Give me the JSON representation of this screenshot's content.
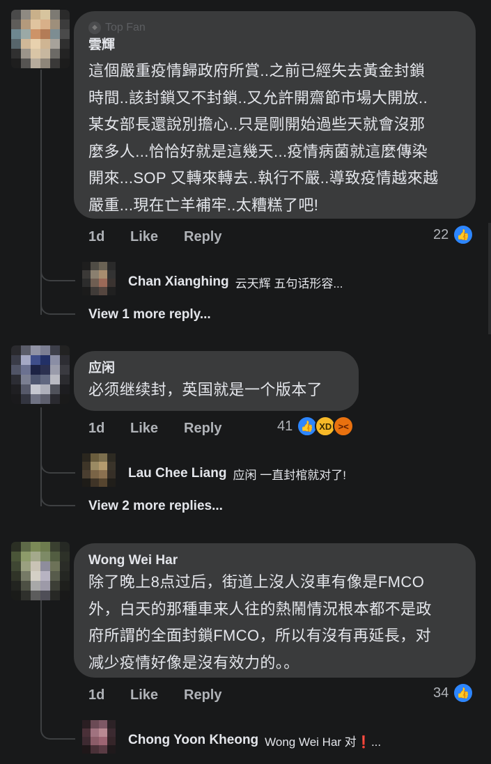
{
  "comments": [
    {
      "badge": "Top Fan",
      "badge_icon": "diamond-icon",
      "author": "雲輝",
      "lines": [
        "這個嚴重疫情歸政府所賞..之前已經失去黃金封鎖",
        "時間..該封鎖又不封鎖..又允許開齋節市場大開放..",
        "某女部長還說別擔心..只是剛開始過些天就會沒那",
        "麼多人...恰恰好就是這幾天...疫情病菌就這麼傳染",
        "開來...SOP 又轉來轉去..執行不嚴..導致疫情越來越",
        "嚴重...現在亡羊補牢..太糟糕了吧!"
      ],
      "age": "1d",
      "like_label": "Like",
      "reply_label": "Reply",
      "reaction_count": "22",
      "reactions": [
        "like-icon"
      ],
      "reply": {
        "author": "Chan Xianghing",
        "text": "云天辉 五句话形容..."
      },
      "more_replies": "View 1 more reply..."
    },
    {
      "author": "应闲",
      "lines": [
        "必须继续封，英国就是一个版本了"
      ],
      "age": "1d",
      "like_label": "Like",
      "reply_label": "Reply",
      "reaction_count": "41",
      "reactions": [
        "like-icon",
        "haha-icon",
        "angry-icon"
      ],
      "reply": {
        "author": "Lau Chee Liang",
        "text": "应闲 一直封棺就对了!"
      },
      "more_replies": "View 2 more replies..."
    },
    {
      "author": "Wong Wei Har",
      "lines": [
        "除了晚上8点过后，街道上沒人沒車有像是FMCO",
        "外，白天的那種車来人往的熱鬧情況根本都不是政",
        "府所謂的全面封鎖FMCO，所以有沒有再延長，对",
        "减少疫情好像是沒有效力的。。"
      ],
      "age": "1d",
      "like_label": "Like",
      "reply_label": "Reply",
      "reaction_count": "34",
      "reactions": [
        "like-icon"
      ],
      "reply": {
        "author": "Chong Yoon Kheong",
        "text": "Wong Wei Har 对❗..."
      }
    }
  ],
  "colors": {
    "background": "#18191a",
    "bubble": "#3a3b3c",
    "text": "#e4e6eb",
    "secondary_text": "#b0b3b8",
    "like_blue": "#2d86ff"
  }
}
